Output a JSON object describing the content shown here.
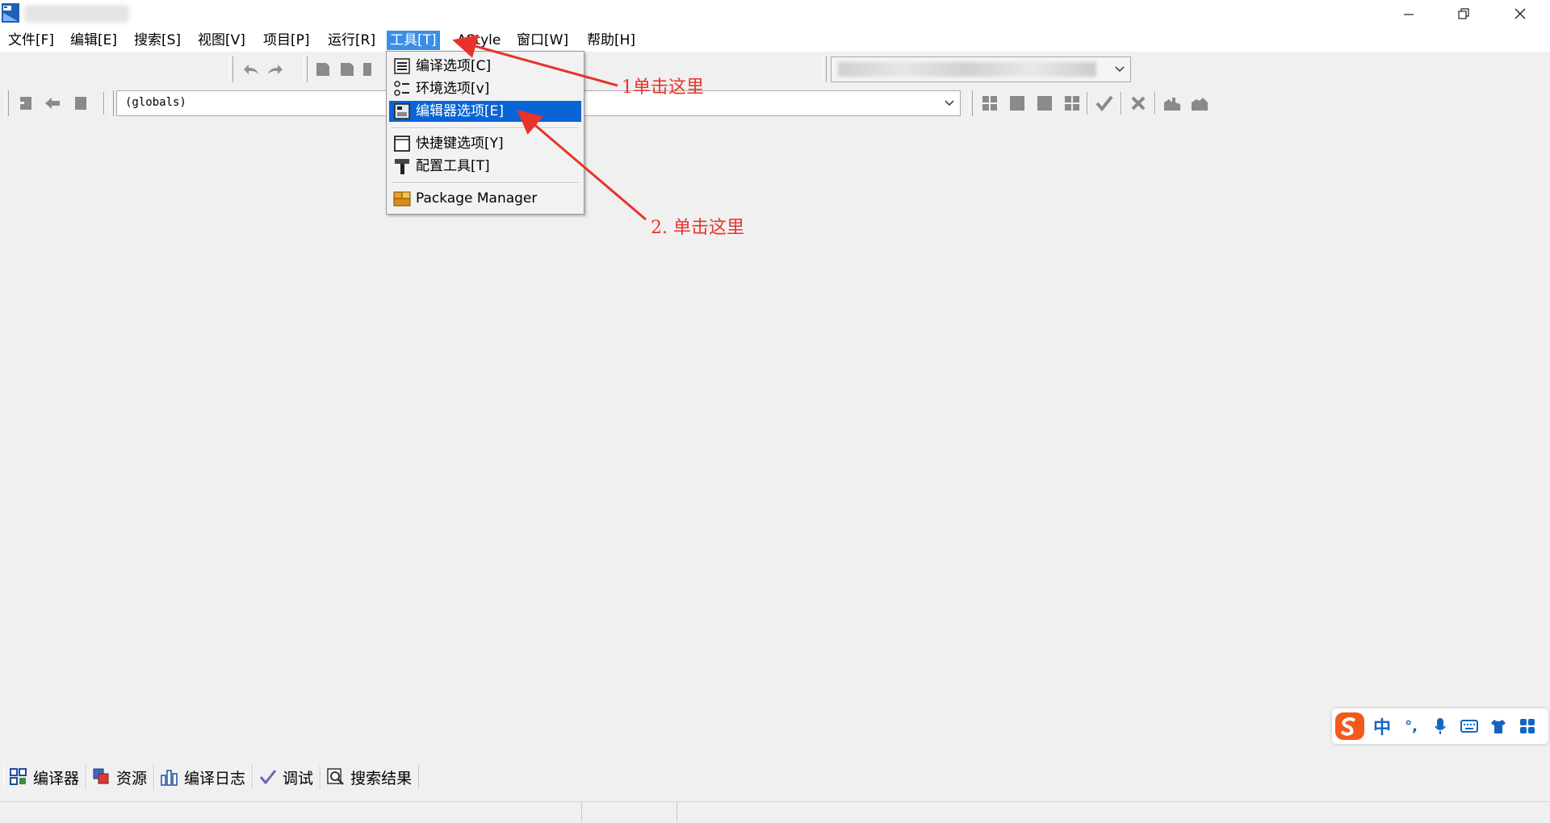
{
  "menubar": {
    "items": [
      {
        "label": "文件[F]"
      },
      {
        "label": "编辑[E]"
      },
      {
        "label": "搜索[S]"
      },
      {
        "label": "视图[V]"
      },
      {
        "label": "项目[P]"
      },
      {
        "label": "运行[R]"
      },
      {
        "label": "工具[T]",
        "active": true
      },
      {
        "label": "AStyle"
      },
      {
        "label": "窗口[W]"
      },
      {
        "label": "帮助[H]"
      }
    ]
  },
  "toolbar": {
    "scope_combo_value": "(globals)"
  },
  "tools_menu": {
    "items": [
      {
        "label": "编译选项[C]",
        "icon": "compiler-options-icon"
      },
      {
        "label": "环境选项[v]",
        "icon": "environment-options-icon"
      },
      {
        "label": "编辑器选项[E]",
        "icon": "editor-options-icon",
        "highlighted": true
      },
      {
        "label": "快捷键选项[Y]",
        "icon": "shortcut-options-icon"
      },
      {
        "label": "配置工具[T]",
        "icon": "hammer-icon"
      },
      {
        "label": "Package Manager",
        "icon": "package-icon"
      }
    ]
  },
  "annotations": {
    "step1": "1单击这里",
    "step2": "2. 单击这里",
    "color": "#e8332b"
  },
  "bottom_tabs": [
    {
      "label": "编译器",
      "icon": "compiler-grid-icon"
    },
    {
      "label": "资源",
      "icon": "resources-icon"
    },
    {
      "label": "编译日志",
      "icon": "compile-log-chart-icon"
    },
    {
      "label": "调试",
      "icon": "debug-check-icon"
    },
    {
      "label": "搜索结果",
      "icon": "search-results-icon"
    }
  ],
  "ime": {
    "mode": "中",
    "punct": "°,"
  },
  "colors": {
    "menu_active": "#3b8ee8",
    "menu_highlight": "#0a64d6",
    "background": "#f0f0f0"
  }
}
